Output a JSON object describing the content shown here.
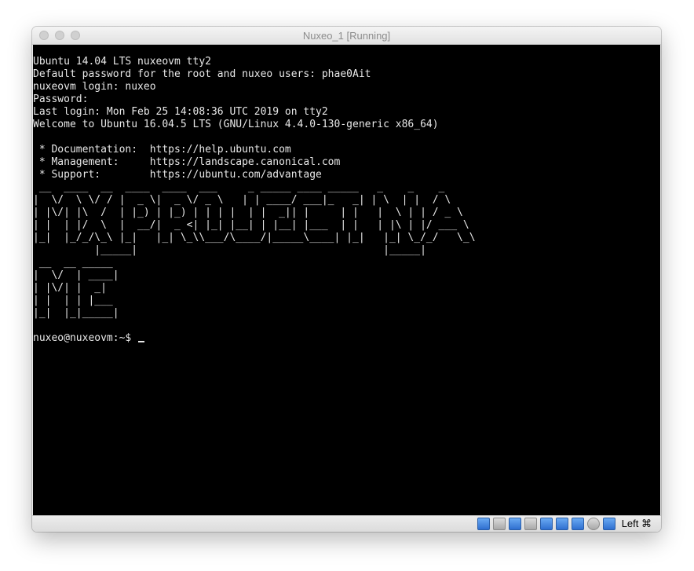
{
  "window": {
    "title": "Nuxeo_1 [Running]",
    "controls": [
      "close",
      "minimize",
      "zoom"
    ]
  },
  "console": {
    "lines": [
      "Ubuntu 14.04 LTS nuxeovm tty2",
      "Default password for the root and nuxeo users: phae0Ait",
      "nuxeovm login: nuxeo",
      "Password:",
      "Last login: Mon Feb 25 14:08:36 UTC 2019 on tty2",
      "Welcome to Ubuntu 16.04.5 LTS (GNU/Linux 4.4.0-130-generic x86_64)",
      "",
      " * Documentation:  https://help.ubuntu.com",
      " * Management:     https://landscape.canonical.com",
      " * Support:        https://ubuntu.com/advantage",
      " __  ____  __  ____  ____  ___     _ _____ ____ _____   _    _    _",
      "|  \\/  \\ \\/ / |  _ \\|  _ \\/ _ \\   | | ____/ ___|_   _| | \\  | |  / \\",
      "| |\\/| |\\  /  | |_) | |_) | | | |  | |  _|| |     | |   |  \\ | | / _ \\",
      "| |  | |/  \\  |  __/|  _ <| |_| |__| | |__| |___  | |   | |\\ | |/ ___ \\",
      "|_|  |_/_/\\_\\ |_|   |_| \\_\\\\___/\\____/|_____\\____| |_|   |_| \\_/_/   \\_\\",
      "          |_____|                                        |_____|",
      " __  __ _____",
      "|  \\/  | ____|",
      "| |\\/| |  _|",
      "| |  | | |___",
      "|_|  |_|_____|",
      "",
      "nuxeo@nuxeovm:~$ "
    ]
  },
  "statusbar": {
    "icons": [
      "hard-disk-icon",
      "optical-drive-icon",
      "network-icon",
      "usb-icon",
      "shared-folder-icon",
      "display-icon",
      "video-capture-icon",
      "cpu-icon",
      "mouse-integration-icon",
      "keyboard-capture-icon"
    ],
    "host_key": "Left ⌘"
  },
  "colors": {
    "screen_bg": "#000000",
    "console_fg": "#e8e8e8",
    "titlebar_bg": "#ececec",
    "title_text": "#8c8c8c"
  }
}
